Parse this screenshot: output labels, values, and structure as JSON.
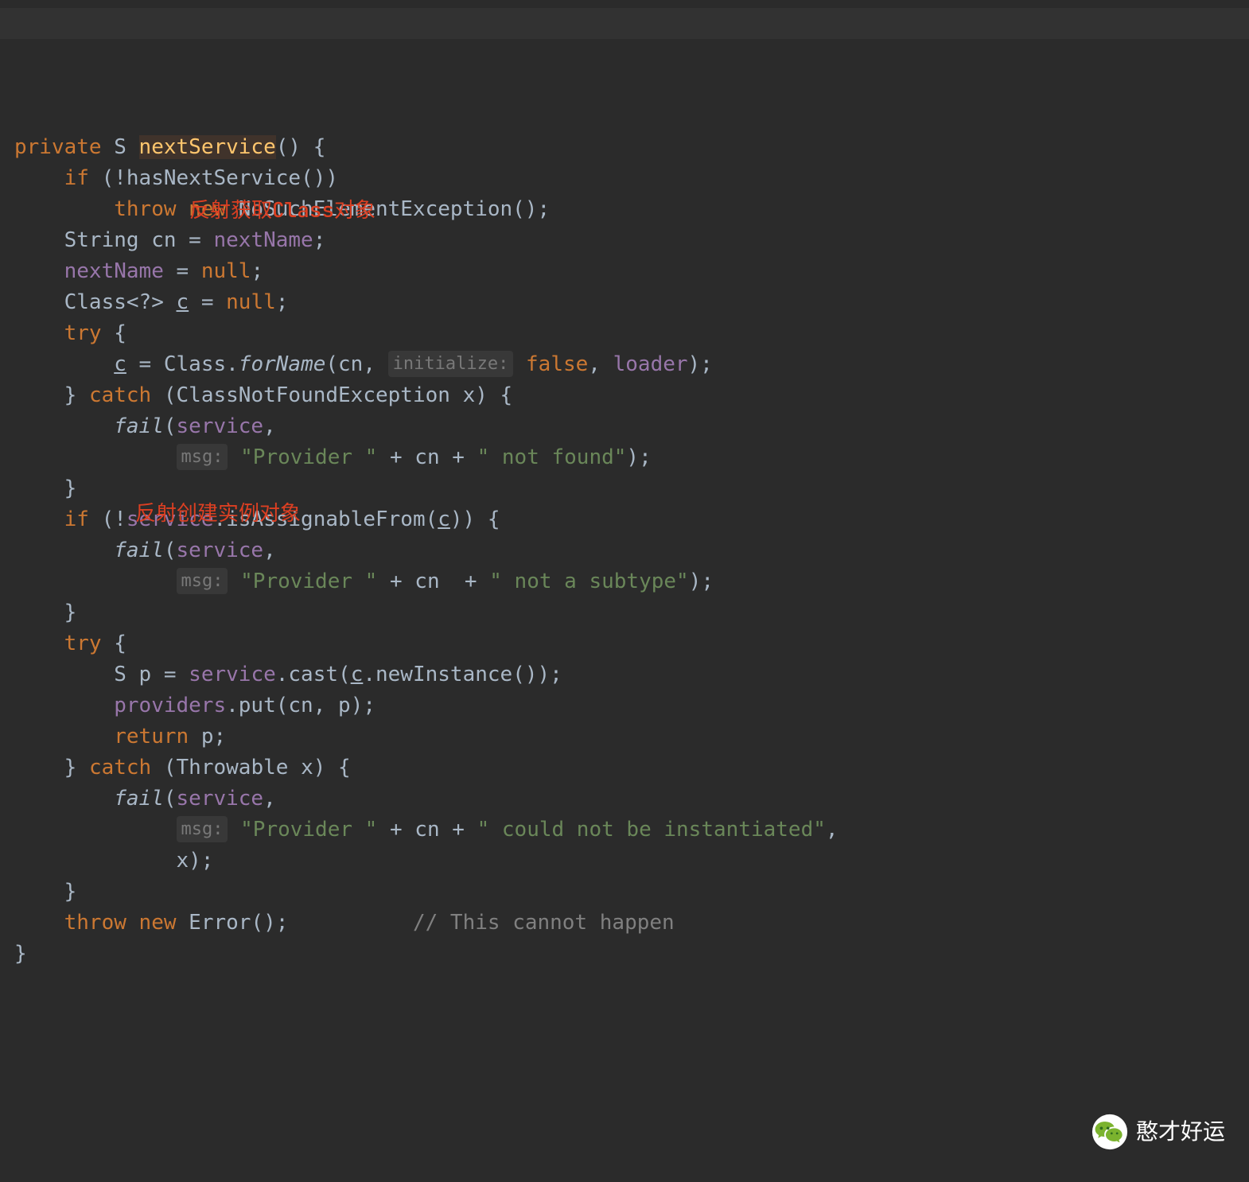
{
  "code": {
    "kw_private": "private",
    "type_S": "S",
    "method_name": "nextService",
    "paren_open": "()",
    "brace_open": "{",
    "kw_if1": "if",
    "cond1_a": "(!",
    "cond1_b": "hasNextService",
    "cond1_c": "())",
    "kw_throw1": "throw new",
    "exc1": "NoSuchElementException",
    "exc1_tail": "()",
    "semi": ";",
    "type_string": "String",
    "var_cn": "cn",
    "eq": "=",
    "ident_nextName1": "nextName",
    "ident_nextName2": "nextName",
    "kw_null1": "null",
    "type_class_decl": "Class<?>",
    "var_c": "c",
    "kw_null2": "null",
    "kw_try1": "try",
    "assign_c": "c",
    "class_ident": "Class",
    "dot": ".",
    "forName": "forName",
    "forName_open": "(",
    "arg_cn1": "cn",
    "comma": ",",
    "hint_initialize": "initialize:",
    "kw_false": "false",
    "arg_loader": "loader",
    "close_paren_semi": ");",
    "brace_close": "}",
    "kw_catch1": "catch",
    "catch1_open": "(",
    "catch1_type": "ClassNotFoundException",
    "catch1_var": "x",
    "close_paren": ")",
    "fail": "fail",
    "fail_open": "(",
    "fail_arg_service": "service",
    "hint_msg": "msg:",
    "str_provider_sp": "\"Provider \"",
    "plus": "+",
    "cn_tok": "cn",
    "str_not_found": "\" not found\"",
    "kw_if2": "if",
    "cond2_a": "(!",
    "cond2_b": "service",
    "cond2_method": "isAssignableFrom",
    "cond2_c": "(",
    "cond2_c2": "c",
    "cond2_close": "))",
    "str_not_subtype": "\" not a subtype\"",
    "kw_try2": "try",
    "type_S2": "S",
    "var_p": "p",
    "svc_tok": "service",
    "cast": "cast",
    "cast_open": "(",
    "c_tok": "c",
    "newInstance": "newInstance",
    "newInstance_tail": "())",
    "providers": "providers",
    "put": "put",
    "put_open": "(",
    "arg_cn2": "cn",
    "arg_p": "p",
    "kw_return": "return",
    "ret_p": "p",
    "catch2_type": "Throwable",
    "catch2_var": "x",
    "str_could_not": "\" could not be instantiated\"",
    "x_tok": "x",
    "kw_throw2": "throw new",
    "error_cls": "Error",
    "error_tail": "()",
    "comment_end": "// This cannot happen"
  },
  "annotations": {
    "a1": "反射获取Class对象",
    "a2": "反射创建实例对象"
  },
  "watermark": {
    "text": "憨才好运"
  }
}
